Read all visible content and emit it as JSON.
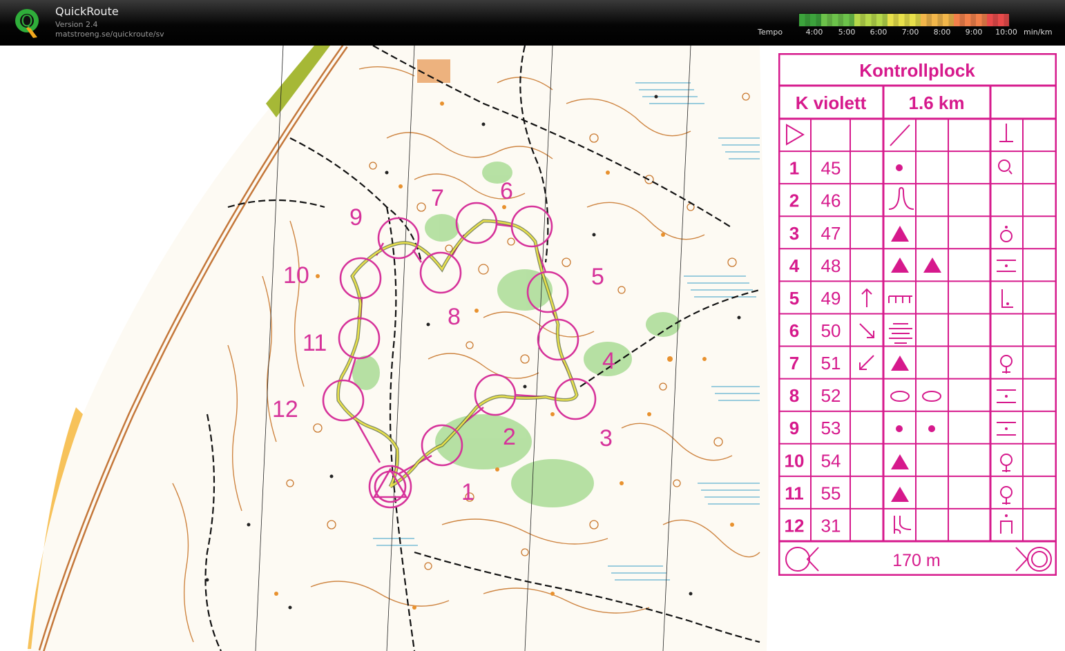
{
  "app": {
    "title": "QuickRoute",
    "version": "Version 2.4",
    "url": "matstroeng.se/quickroute/sv",
    "logo_letter": "Q"
  },
  "tempo": {
    "label": "Tempo",
    "ticks": [
      "4:00",
      "5:00",
      "6:00",
      "7:00",
      "8:00",
      "9:00",
      "10:00"
    ],
    "unit": "min/km",
    "colors": [
      "#3ca33c",
      "#6cc24a",
      "#b6d84a",
      "#e8e04a",
      "#f2b64a",
      "#f2804a",
      "#e84a4a"
    ]
  },
  "map": {
    "controls": [
      "1",
      "2",
      "3",
      "4",
      "5",
      "6",
      "7",
      "8",
      "9",
      "10",
      "11",
      "12"
    ],
    "colors": {
      "course": "#d6329a",
      "route": "#e8e04a",
      "contour": "#c9782e",
      "green": "#9fd889",
      "water": "#3aa0c8"
    }
  },
  "sheet": {
    "title": "Kontrollplock",
    "class_name": "K violett",
    "distance": "1.6 km",
    "finish_distance": "170 m",
    "rows": [
      {
        "num": "1",
        "code": "45"
      },
      {
        "num": "2",
        "code": "46"
      },
      {
        "num": "3",
        "code": "47"
      },
      {
        "num": "4",
        "code": "48"
      },
      {
        "num": "5",
        "code": "49"
      },
      {
        "num": "6",
        "code": "50"
      },
      {
        "num": "7",
        "code": "51"
      },
      {
        "num": "8",
        "code": "52"
      },
      {
        "num": "9",
        "code": "53"
      },
      {
        "num": "10",
        "code": "54"
      },
      {
        "num": "11",
        "code": "55"
      },
      {
        "num": "12",
        "code": "31"
      }
    ],
    "color": "#d6198c"
  }
}
